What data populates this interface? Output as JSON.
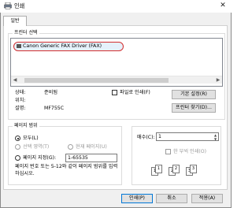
{
  "window": {
    "title": "인쇄",
    "close_glyph": "✕"
  },
  "tabs": [
    {
      "label": "일반"
    }
  ],
  "printer_select": {
    "group_label": "프린터 선택",
    "selected_printer": "Canon Generic FAX Driver (FAX)"
  },
  "status": {
    "status_label": "상태:",
    "status_value": "준비됨",
    "location_label": "위치:",
    "location_value": "",
    "comment_label": "설명:",
    "comment_value": "MF755C"
  },
  "print_to_file": {
    "label": "파일로 인쇄(F)",
    "checked": false
  },
  "buttons": {
    "preferences": "기본 설정(R)",
    "find_printer": "프린터 찾기(D)...",
    "print": "인쇄(P)",
    "cancel": "취소",
    "apply": "적용(A)"
  },
  "page_range": {
    "group_label": "페이지 범위",
    "all": "모두(L)",
    "selection": "선택 영역(T)",
    "current_page": "현재 페이지(U)",
    "pages": "페이지 지정(G):",
    "pages_value": "1-65535",
    "help_text": "페이지 번호 또는 5-12와 같이 페이지 범위를 입력하십시오."
  },
  "copies": {
    "label": "매수(C):",
    "value": "1",
    "collate_label": "한 부씩 인쇄(O)",
    "collate_checked": false,
    "illustration_pages": [
      "1",
      "1",
      "2",
      "2",
      "3",
      "3"
    ]
  },
  "icons": [
    "printer-icon",
    "close-icon",
    "scroll-left-icon",
    "scroll-right-icon",
    "spin-up-icon",
    "spin-down-icon"
  ]
}
